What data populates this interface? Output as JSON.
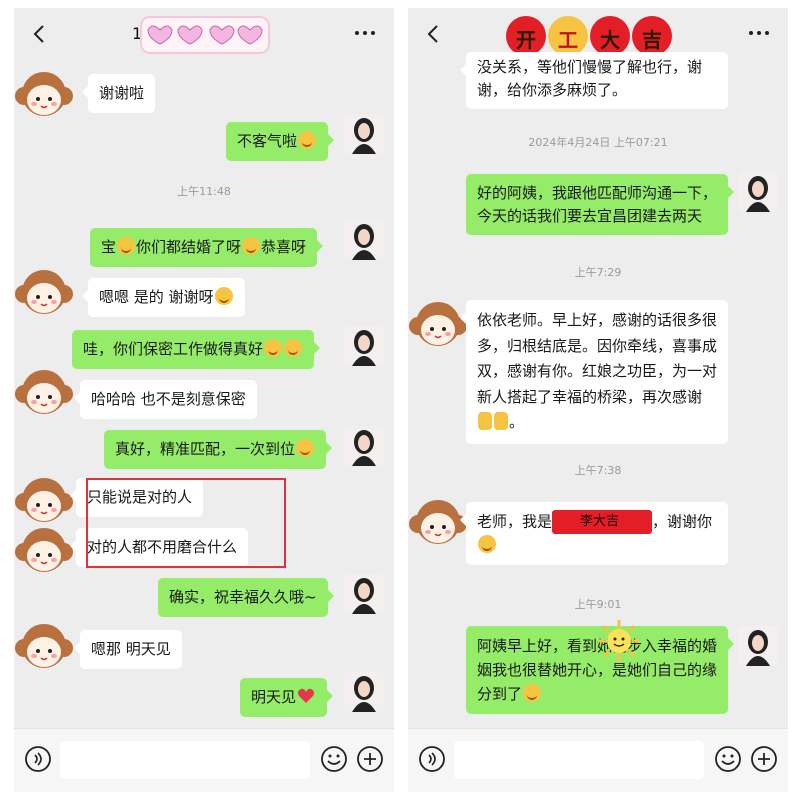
{
  "left": {
    "title": "1",
    "messages": [
      {
        "text": "谢谢啦"
      },
      {
        "text": "不客气啦"
      },
      {
        "time": "上午11:48"
      },
      {
        "text_a": "宝",
        "text_b": "你们都结婚了呀",
        "text_c": "恭喜呀"
      },
      {
        "text": "嗯嗯 是的 谢谢呀"
      },
      {
        "text": "哇，你们保密工作做得真好"
      },
      {
        "text": "哈哈哈 也不是刻意保密"
      },
      {
        "text": "真好，精准匹配，一次到位"
      },
      {
        "text": "只能说是对的人"
      },
      {
        "text": "对的人都不用磨合什么"
      },
      {
        "text": "确实，祝幸福久久哦~"
      },
      {
        "text": "嗯那 明天见"
      },
      {
        "text": "明天见"
      }
    ]
  },
  "right": {
    "sticker_text": [
      "开",
      "工",
      "大",
      "吉"
    ],
    "messages": [
      {
        "line1": "没关系，等他们慢慢了解也行，谢",
        "line2": "谢，给你添多麻烦了。"
      },
      {
        "time": "2024年4月24日 上午07:21"
      },
      {
        "line1": "好的阿姨，我跟他匹配师沟通一下，",
        "line2": "今天的话我们要去宜昌团建去两天"
      },
      {
        "time": "上午7:29"
      },
      {
        "text": "依依老师。早上好，感谢的话很多很多，归根结底是。因你牵线，喜事成双，感谢有你。红娘之功臣，为一对新人搭起了幸福的桥梁，再次感谢"
      },
      {
        "time": "上午7:38"
      },
      {
        "text_a": "老师，我是",
        "stamp": "李大吉",
        "text_b": "，谢谢你"
      },
      {
        "time": "上午9:01"
      },
      {
        "text": "阿姨早上好，看到她们步入幸福的婚姻我也很替她开心，是她们自己的缘分到了"
      }
    ]
  },
  "colors": {
    "outgoing": "#95ec69",
    "incoming": "#ffffff",
    "background": "#ededed",
    "highlight": "#e0323a"
  },
  "icons": [
    "back-arrow-icon",
    "more-icon",
    "voice-icon",
    "emoji-icon",
    "plus-icon",
    "heart-emoji",
    "smile-emoji",
    "pray-emoji",
    "sun-sticker"
  ]
}
